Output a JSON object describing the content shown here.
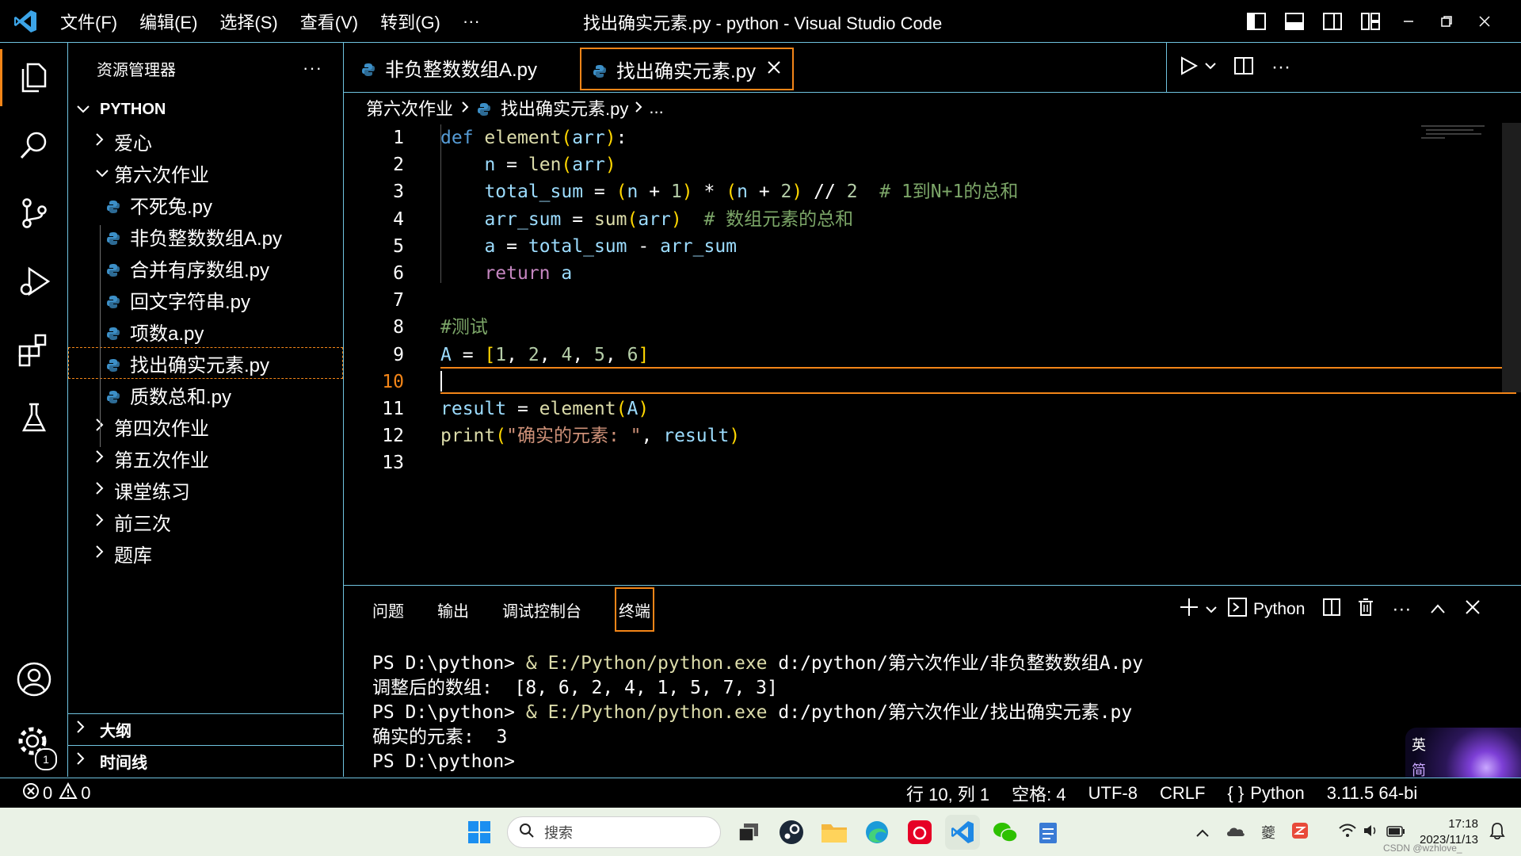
{
  "window": {
    "title": "找出确实元素.py - python - Visual Studio Code",
    "menu": [
      "文件(F)",
      "编辑(E)",
      "选择(S)",
      "查看(V)",
      "转到(G)",
      "···"
    ]
  },
  "sidebar": {
    "header": "资源管理器",
    "root": "PYTHON",
    "items": [
      {
        "label": "爱心",
        "type": "folder",
        "expanded": false
      },
      {
        "label": "第六次作业",
        "type": "folder",
        "expanded": true
      },
      {
        "label": "不死兔.py",
        "type": "file"
      },
      {
        "label": "非负整数数组A.py",
        "type": "file"
      },
      {
        "label": "合并有序数组.py",
        "type": "file"
      },
      {
        "label": "回文字符串.py",
        "type": "file"
      },
      {
        "label": "项数a.py",
        "type": "file"
      },
      {
        "label": "找出确实元素.py",
        "type": "file",
        "selected": true
      },
      {
        "label": "质数总和.py",
        "type": "file"
      },
      {
        "label": "第四次作业",
        "type": "folder",
        "expanded": false
      },
      {
        "label": "第五次作业",
        "type": "folder",
        "expanded": false
      },
      {
        "label": "课堂练习",
        "type": "folder",
        "expanded": false
      },
      {
        "label": "前三次",
        "type": "folder",
        "expanded": false
      },
      {
        "label": "题库",
        "type": "folder",
        "expanded": false
      }
    ],
    "outline": "大纲",
    "timeline": "时间线"
  },
  "tabs": [
    {
      "label": "非负整数数组A.py",
      "active": false
    },
    {
      "label": "找出确实元素.py",
      "active": true
    }
  ],
  "breadcrumb": {
    "folder": "第六次作业",
    "file": "找出确实元素.py",
    "more": "..."
  },
  "code": {
    "current_line": 10,
    "line_numbers": [
      "1",
      "2",
      "3",
      "4",
      "5",
      "6",
      "7",
      "8",
      "9",
      "10",
      "11",
      "12",
      "13"
    ],
    "lines": [
      "def element(arr):",
      "    n = len(arr)",
      "    total_sum = (n + 1) * (n + 2) // 2  # 1到N+1的总和",
      "    arr_sum = sum(arr)  # 数组元素的总和",
      "    a = total_sum - arr_sum",
      "    return a",
      "",
      "#测试",
      "A = [1, 2, 4, 5, 6]",
      "",
      "result = element(A)",
      "print(\"确实的元素: \", result)",
      ""
    ]
  },
  "panel": {
    "tabs": [
      "问题",
      "输出",
      "调试控制台",
      "终端"
    ],
    "active_tab": "终端",
    "shell_label": "Python",
    "terminal": {
      "prompt1": "PS D:\\python> ",
      "amp": "& ",
      "exe": "E:/Python/python.exe",
      "script1": " d:/python/第六次作业/非负整数数组A.py",
      "out1": "调整后的数组:  [8, 6, 2, 4, 1, 5, 7, 3]",
      "prompt2": "PS D:\\python> ",
      "script2": " d:/python/第六次作业/找出确实元素.py",
      "out2": "确实的元素:  3",
      "prompt3": "PS D:\\python>"
    }
  },
  "status": {
    "errors": "0",
    "warnings": "0",
    "position": "行 10, 列 1",
    "spaces": "空格: 4",
    "encoding": "UTF-8",
    "eol": "CRLF",
    "language": "Python",
    "interpreter": "3.11.5 64-bi",
    "settings_badge": "1"
  },
  "ime": {
    "lang": "英",
    "mode": "简"
  },
  "taskbar": {
    "search_placeholder": "搜索",
    "tray_text": "夔",
    "time": "17:18",
    "date": "2023/11/13",
    "watermark": "CSDN @wzhlove_"
  },
  "colors": {
    "focus_border": "#6fc3df",
    "active_border": "#f38518",
    "taskbar_bg": "#eaf2e6"
  }
}
